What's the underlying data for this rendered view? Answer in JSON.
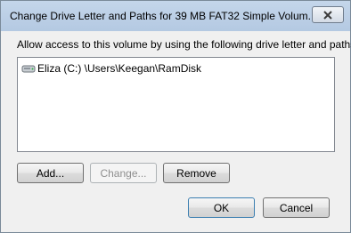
{
  "window": {
    "title": "Change Drive Letter and Paths for 39 MB FAT32 Simple Volum..."
  },
  "instruction": "Allow access to this volume by using the following drive letter and paths:",
  "paths": [
    {
      "label": "Eliza (C:) \\Users\\Keegan\\RamDisk",
      "icon": "drive-icon"
    }
  ],
  "buttons": {
    "add": "Add...",
    "change": "Change...",
    "remove": "Remove",
    "ok": "OK",
    "cancel": "Cancel"
  }
}
